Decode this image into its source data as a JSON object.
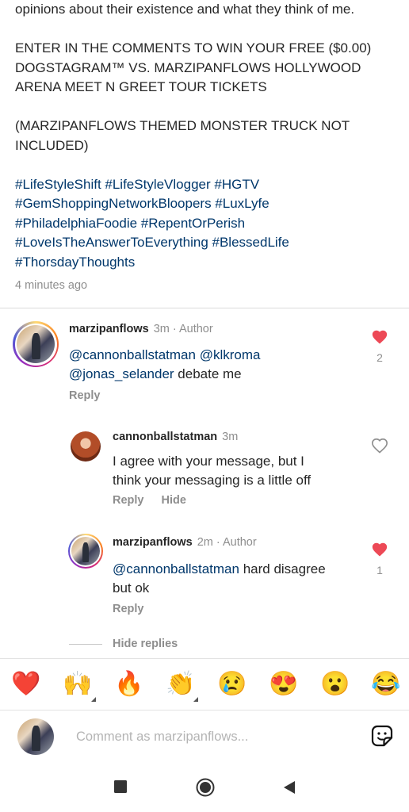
{
  "caption": {
    "line1": "opinions about their existence and what they think of me.",
    "para2": [
      "ENTER IN THE COMMENTS TO WIN YOUR FREE ($0.00)",
      "DOGSTAGRAM™ VS. MARZIPANFLOWS HOLLYWOOD",
      "ARENA MEET N GREET TOUR TICKETS"
    ],
    "para3": [
      "(MARZIPANFLOWS THEMED MONSTER TRUCK NOT",
      "INCLUDED)"
    ],
    "hashtags": [
      "#LifeStyleShift #LifeStyleVlogger #HGTV",
      "#GemShoppingNetworkBloopers #LuxLyfe",
      "#PhiladelphiaFoodie #RepentOrPerish",
      "#LoveIsTheAnswerToEverything #BlessedLife",
      "#ThorsdayThoughts"
    ],
    "timestamp": "4 minutes ago"
  },
  "comments": [
    {
      "username": "marzipanflows",
      "ago": "3m",
      "author_label": "Author",
      "mention1": "@cannonballstatman",
      "mention2": "@klkroma",
      "mention3": "@jonas_selander",
      "text": " debate me",
      "reply_label": "Reply",
      "likes": "2",
      "liked": true
    },
    {
      "username": "cannonballstatman",
      "ago": "3m",
      "line1": "I agree with your message, but I",
      "line2": "think your messaging is a little off",
      "reply_label": "Reply",
      "hide_label": "Hide",
      "liked": false
    },
    {
      "username": "marzipanflows",
      "ago": "2m",
      "author_label": "Author",
      "mention1": "@cannonballstatman",
      "line1_rest": " hard disagree",
      "line2": "but ok",
      "reply_label": "Reply",
      "likes": "1",
      "liked": true
    }
  ],
  "hide_replies": "Hide replies",
  "emoji_bar": [
    "❤️",
    "🙌",
    "🔥",
    "👏",
    "😢",
    "😍",
    "😮",
    "😂"
  ],
  "composer": {
    "placeholder": "Comment as marzipanflows..."
  },
  "colors": {
    "heart": "#ed4956",
    "link": "#00376b",
    "muted": "#8e8e8e"
  },
  "icons": {
    "like": "heart-icon",
    "sticker": "sticker-icon",
    "nav": [
      "recents-square-icon",
      "home-circle-icon",
      "back-triangle-icon"
    ]
  }
}
